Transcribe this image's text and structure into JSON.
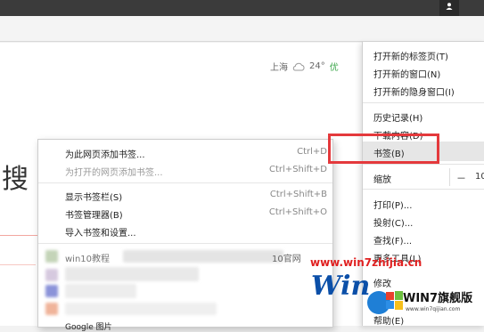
{
  "weather": {
    "city": "上海",
    "temperature": "24°",
    "aqi": "优"
  },
  "page": {
    "search_text": "搜"
  },
  "main_menu": {
    "items": [
      {
        "label": "打开新的标签页(T)"
      },
      {
        "label": "打开新的窗口(N)"
      },
      {
        "label": "打开新的隐身窗口(I)"
      },
      {
        "label": "历史记录(H)"
      },
      {
        "label": "下载内容(D)"
      },
      {
        "label": "书签(B)"
      },
      {
        "label": "缩放"
      },
      {
        "label": "打印(P)..."
      },
      {
        "label": "投射(C)..."
      },
      {
        "label": "查找(F)..."
      },
      {
        "label": "更多工具(L)"
      },
      {
        "label": "修改"
      },
      {
        "label": "帮助(E)"
      }
    ],
    "zoom": {
      "minus": "－",
      "value": "10"
    }
  },
  "bookmarks_submenu": {
    "items": [
      {
        "label": "为此网页添加书签...",
        "shortcut": "Ctrl+D"
      },
      {
        "label": "为打开的网页添加书签...",
        "shortcut": "Ctrl+Shift+D"
      },
      {
        "label": "显示书签栏(S)",
        "shortcut": "Ctrl+Shift+B"
      },
      {
        "label": "书签管理器(B)",
        "shortcut": "Ctrl+Shift+O"
      },
      {
        "label": "导入书签和设置..."
      },
      {
        "label": "win10教程",
        "shortcut": "10官网"
      },
      {
        "label": "Google 图片"
      }
    ]
  },
  "watermark": {
    "url_text": "www.win7zhijia.cn",
    "logo_text": "Win",
    "brand": "WIN7旗舰版",
    "brand_url": "www.win7qijian.com"
  },
  "colors": {
    "highlight": "#e4393c",
    "topbar": "#3b3b3b",
    "aqi": "#3ba64a"
  }
}
